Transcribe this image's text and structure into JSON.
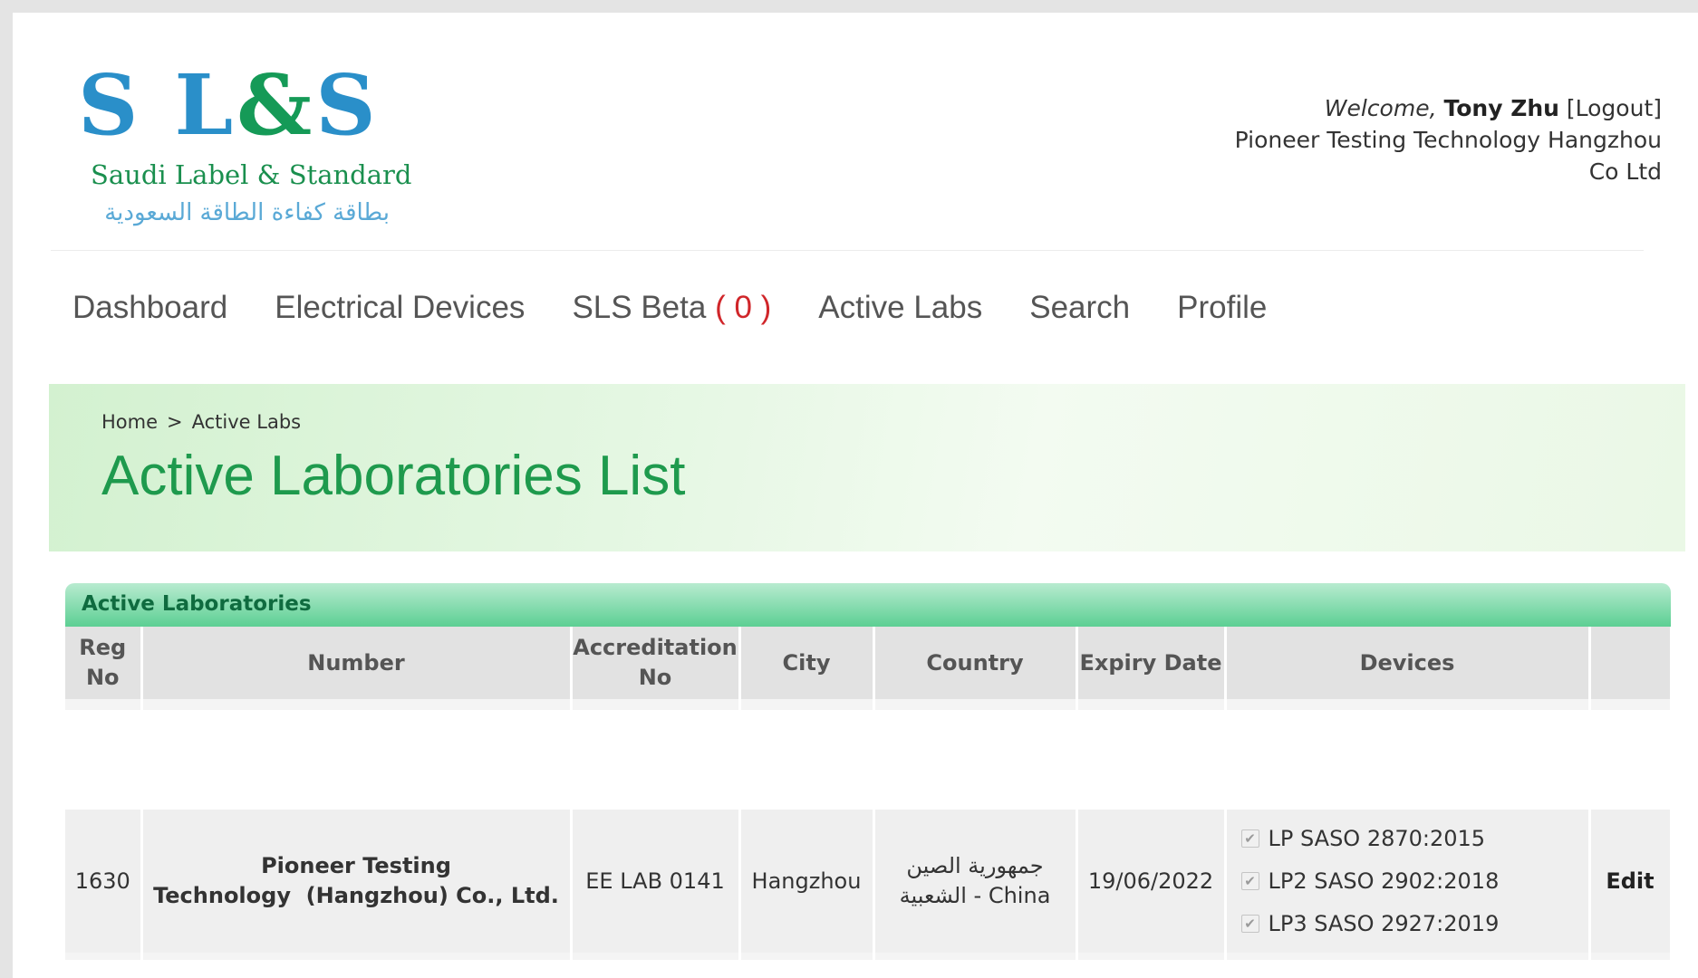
{
  "logo": {
    "initial_1": "S",
    "initial_2": "L",
    "ampersand": "&",
    "initial_3": "S",
    "subtitle": "Saudi Label & Standard",
    "arabic": "بطاقة كفاءة الطاقة السعودية"
  },
  "user": {
    "welcome": "Welcome,",
    "name": "Tony Zhu",
    "logout": "[Logout]",
    "company_line1": "Pioneer Testing Technology Hangzhou",
    "company_line2": "Co Ltd"
  },
  "nav": {
    "items": [
      {
        "label": "Dashboard"
      },
      {
        "label": "Electrical Devices"
      },
      {
        "label": "SLS Beta",
        "count": "( 0 )"
      },
      {
        "label": "Active Labs"
      },
      {
        "label": "Search"
      },
      {
        "label": "Profile"
      }
    ]
  },
  "breadcrumb": {
    "home": "Home",
    "separator": ">",
    "current": "Active Labs"
  },
  "page_title": "Active Laboratories List",
  "panel": {
    "title": "Active Laboratories",
    "columns": [
      "Reg No",
      "Number",
      "Accreditation No",
      "City",
      "Country",
      "Expiry Date",
      "Devices",
      ""
    ],
    "rows": [
      {
        "reg_no": "1630",
        "number": "Pioneer Testing Technology (Hangzhou) Co., Ltd.",
        "accreditation_no": "EE LAB 0141",
        "city": "Hangzhou",
        "country": "جمهورية الصين الشعبية - China",
        "expiry_date": "19/06/2022",
        "devices": [
          "LP SASO 2870:2015",
          "LP2 SASO 2902:2018",
          "LP3 SASO 2927:2019"
        ],
        "action": "Edit"
      }
    ]
  },
  "colors": {
    "logo_blue": "#2a8fc9",
    "logo_green": "#159a57",
    "title_green": "#1e9a4d",
    "count_red": "#d0262a"
  }
}
